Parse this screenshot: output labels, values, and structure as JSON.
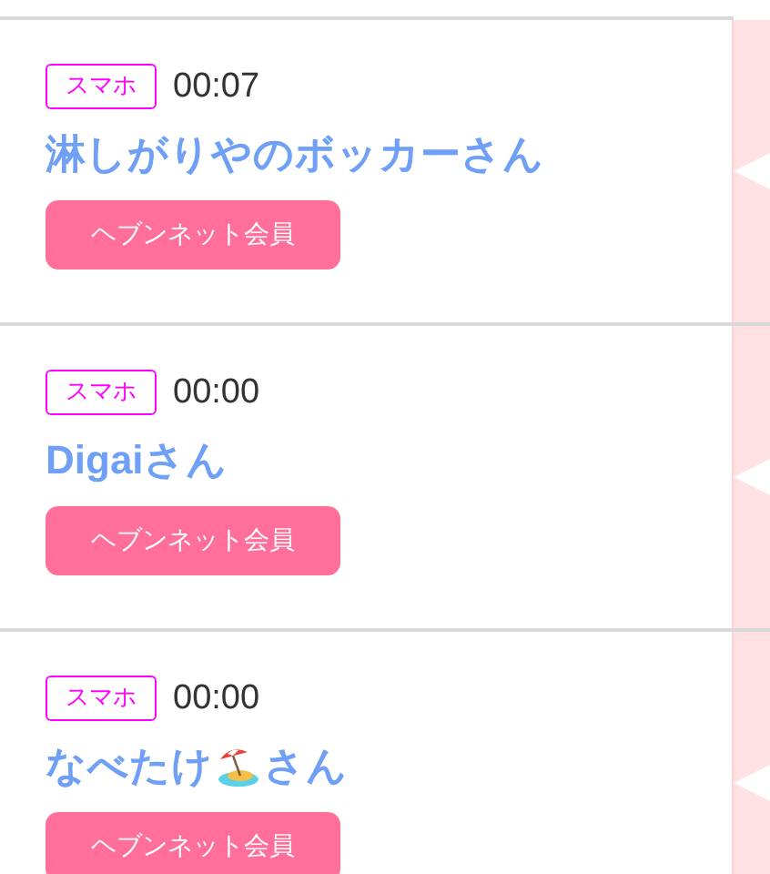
{
  "entries": [
    {
      "device": "スマホ",
      "time": "00:07",
      "name": "淋しがりやのボッカー",
      "emoji": false,
      "suffix": "さん",
      "badge": "ヘブンネット会員"
    },
    {
      "device": "スマホ",
      "time": "00:00",
      "name": "Digai",
      "emoji": false,
      "suffix": "さん",
      "badge": "ヘブンネット会員"
    },
    {
      "device": "スマホ",
      "time": "00:00",
      "name": "なべたけ",
      "emoji": true,
      "suffix": "さん",
      "badge": "ヘブンネット会員"
    }
  ]
}
